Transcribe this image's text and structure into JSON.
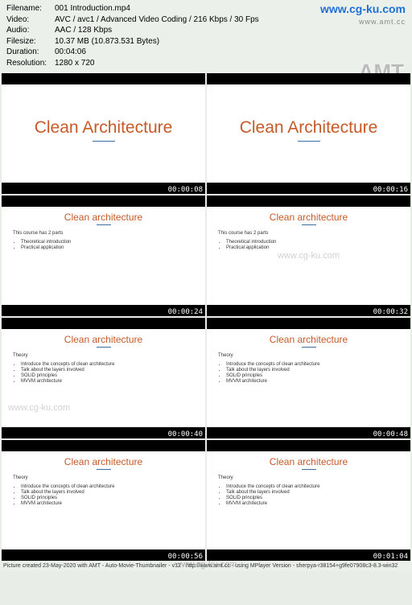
{
  "watermark": {
    "url": "www.cg-ku.com",
    "sub": "www.amt.cc",
    "amt": "AMT"
  },
  "info": {
    "filename_l": "Filename:",
    "filename_v": "001 Introduction.mp4",
    "video_l": "Video:",
    "video_v": "AVC / avc1 / Advanced Video Coding / 216 Kbps / 30 Fps",
    "audio_l": "Audio:",
    "audio_v": "AAC / 128 Kbps",
    "filesize_l": "Filesize:",
    "filesize_v": "10.37 MB (10.873.531 Bytes)",
    "duration_l": "Duration:",
    "duration_v": "00:04:06",
    "resolution_l": "Resolution:",
    "resolution_v": "1280 x 720"
  },
  "slides": [
    {
      "type": "title",
      "title": "Clean Architecture",
      "time": "00:00:08"
    },
    {
      "type": "title",
      "title": "Clean Architecture",
      "time": "00:00:16"
    },
    {
      "type": "parts",
      "title": "Clean architecture",
      "lead": "This course has 2 parts",
      "bullets": [
        "Theoretical introduction",
        "Practical application"
      ],
      "time": "00:00:24"
    },
    {
      "type": "parts",
      "title": "Clean architecture",
      "lead": "This course has 2 parts",
      "bullets": [
        "Theoretical introduction",
        "Practical application"
      ],
      "time": "00:00:32"
    },
    {
      "type": "theory",
      "title": "Clean architecture",
      "lead": "Theory",
      "bullets": [
        "Introduce the concepts of clean architecture",
        "Talk about the layers involved",
        "SOLID principles",
        "MVVM architecture"
      ],
      "time": "00:00:40"
    },
    {
      "type": "theory",
      "title": "Clean architecture",
      "lead": "Theory",
      "bullets": [
        "Introduce the concepts of clean architecture",
        "Talk about the layers involved",
        "SOLID principles",
        "MVVM architecture"
      ],
      "time": "00:00:48"
    },
    {
      "type": "theory",
      "title": "Clean architecture",
      "lead": "Theory",
      "bullets": [
        "Introduce the concepts of clean architecture",
        "Talk about the layers involved",
        "SOLID principles",
        "MVVM architecture"
      ],
      "time": "00:00:56"
    },
    {
      "type": "theory",
      "title": "Clean architecture",
      "lead": "Theory",
      "bullets": [
        "Introduce the concepts of clean architecture",
        "Talk about the layers involved",
        "SOLID principles",
        "MVVM architecture"
      ],
      "time": "00:01:04"
    }
  ],
  "footer": "Picture created 23-May-2020 with AMT - Auto-Movie-Thumbnailer - v12 - http://www.amt.cc - using MPlayer Version - sherpya-r38154+g9fe07908c3-8.3-win32"
}
